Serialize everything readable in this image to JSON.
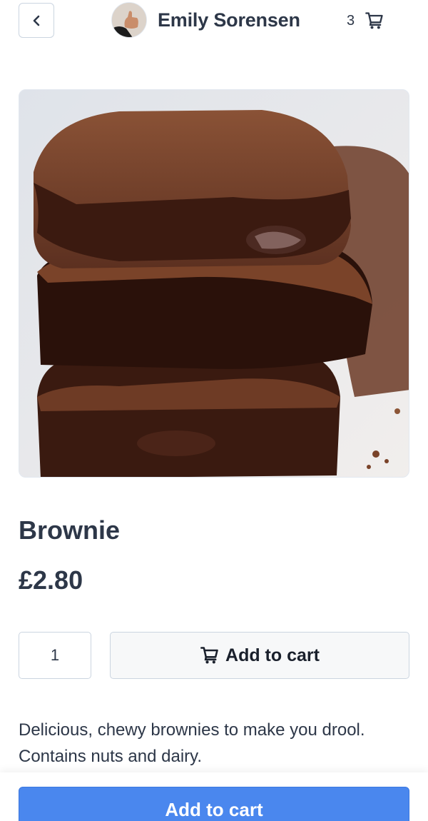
{
  "header": {
    "seller_name": "Emily Sorensen",
    "cart_count": "3"
  },
  "product": {
    "title": "Brownie",
    "price": "£2.80",
    "quantity": "1",
    "add_to_cart_label": "Add to cart",
    "description": "Delicious, chewy brownies to make you drool. Contains nuts and dairy."
  },
  "bottom_bar": {
    "button_label": "Add to cart"
  },
  "icons": {
    "back": "chevron-left-icon",
    "cart": "cart-icon"
  },
  "colors": {
    "primary": "#4a87ee",
    "text": "#2d3748"
  }
}
